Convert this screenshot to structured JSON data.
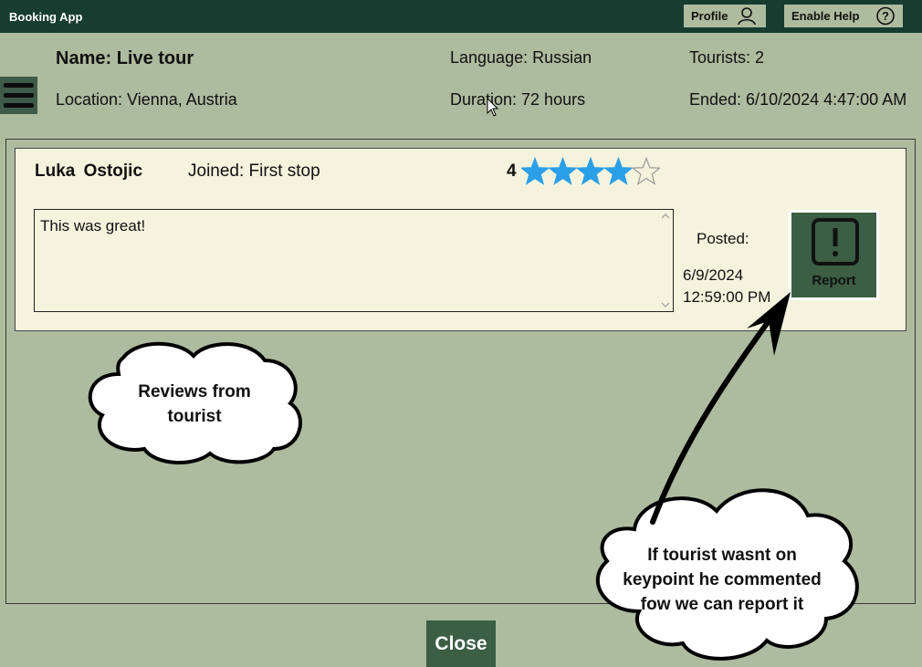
{
  "window": {
    "title": "Booking App"
  },
  "header": {
    "profile_label": "Profile",
    "help_label": "Enable Help"
  },
  "tour": {
    "name": "Name: Live tour",
    "location": "Location: Vienna, Austria",
    "language": "Language: Russian",
    "duration": "Duration: 72 hours",
    "tourists": "Tourists: 2",
    "ended": "Ended: 6/10/2024 4:47:00 AM"
  },
  "review": {
    "reviewer": "Luka  Ostojic",
    "joined": "Joined: First stop",
    "rating": "4",
    "rating_value": 4,
    "rating_max": 5,
    "comment": "This was great!",
    "posted_label": "Posted:",
    "posted_date": "6/9/2024",
    "posted_time": "12:59:00 PM",
    "report_label": "Report"
  },
  "footer": {
    "close_label": "Close"
  },
  "annotations": {
    "reviews_note": [
      "Reviews from",
      "tourist"
    ],
    "report_note": [
      "If tourist wasnt on",
      "keypoint he commented",
      "fow we can report it"
    ]
  },
  "colors": {
    "titlebar": "#173c30",
    "background": "#adbb9e",
    "card": "#f4f3dd",
    "button": "#3b5e45",
    "star": "#2b9fe8"
  }
}
